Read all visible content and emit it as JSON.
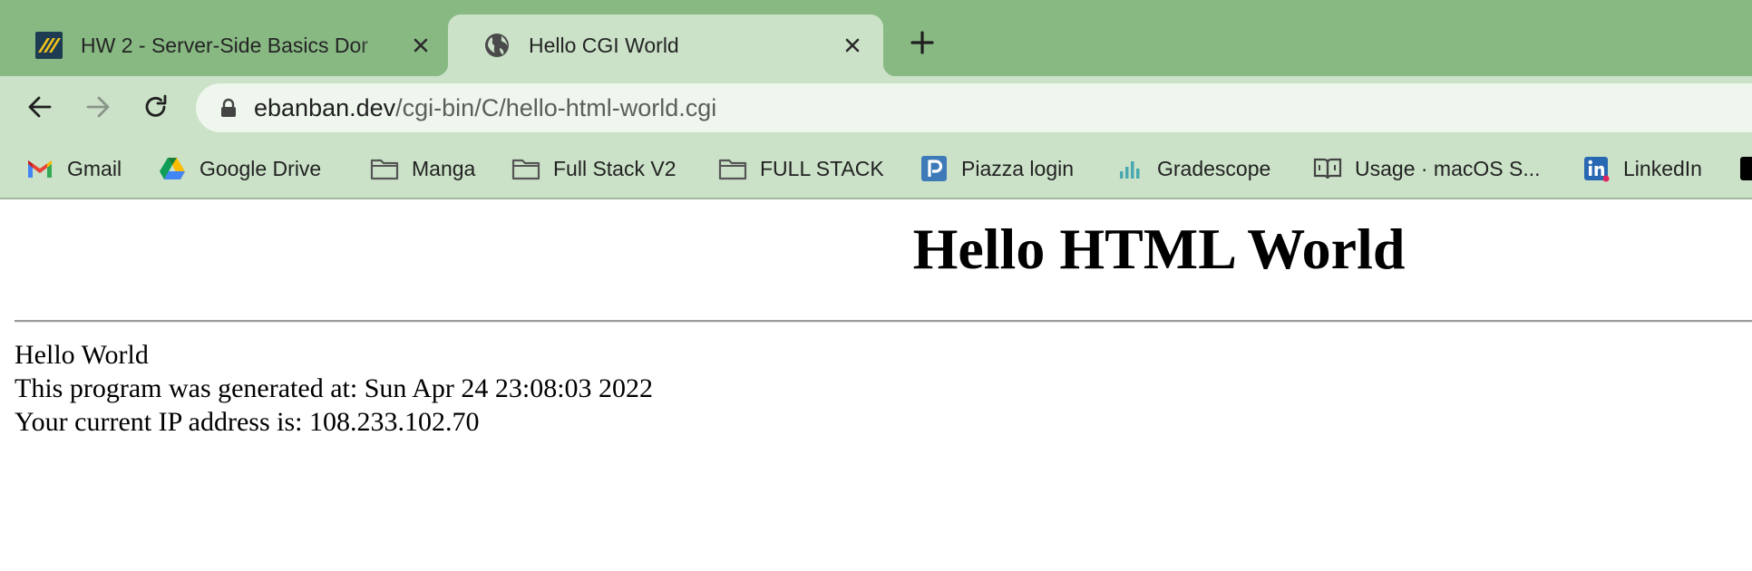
{
  "browser": {
    "tabs": [
      {
        "title": "HW 2 - Server-Side Basics Dor",
        "icon": "pencil-stripes-icon",
        "active": false
      },
      {
        "title": "Hello CGI World",
        "icon": "globe-icon",
        "active": true
      }
    ],
    "address_bar": {
      "host": "ebanban.dev",
      "path": "/cgi-bin/C/hello-html-world.cgi"
    },
    "bookmarks": [
      {
        "label": "Gmail",
        "icon": "gmail-icon"
      },
      {
        "label": "Google Drive",
        "icon": "google-drive-icon"
      },
      {
        "label": "Manga",
        "icon": "folder-icon"
      },
      {
        "label": "Full Stack V2",
        "icon": "folder-icon"
      },
      {
        "label": "FULL STACK",
        "icon": "folder-icon"
      },
      {
        "label": "Piazza login",
        "icon": "piazza-icon"
      },
      {
        "label": "Gradescope",
        "icon": "gradescope-icon"
      },
      {
        "label": "Usage · macOS S...",
        "icon": "book-icon"
      },
      {
        "label": "LinkedIn",
        "icon": "linkedin-icon"
      },
      {
        "label": "",
        "icon": "dev-icon"
      }
    ],
    "colors": {
      "frame": "#88b983",
      "toolbar": "#cbe2c8",
      "omnibox": "#eef6ed"
    }
  },
  "page": {
    "heading": "Hello HTML World",
    "lines": [
      "Hello World",
      "This program was generated at: Sun Apr 24 23:08:03 2022",
      "Your current IP address is: 108.233.102.70"
    ]
  }
}
